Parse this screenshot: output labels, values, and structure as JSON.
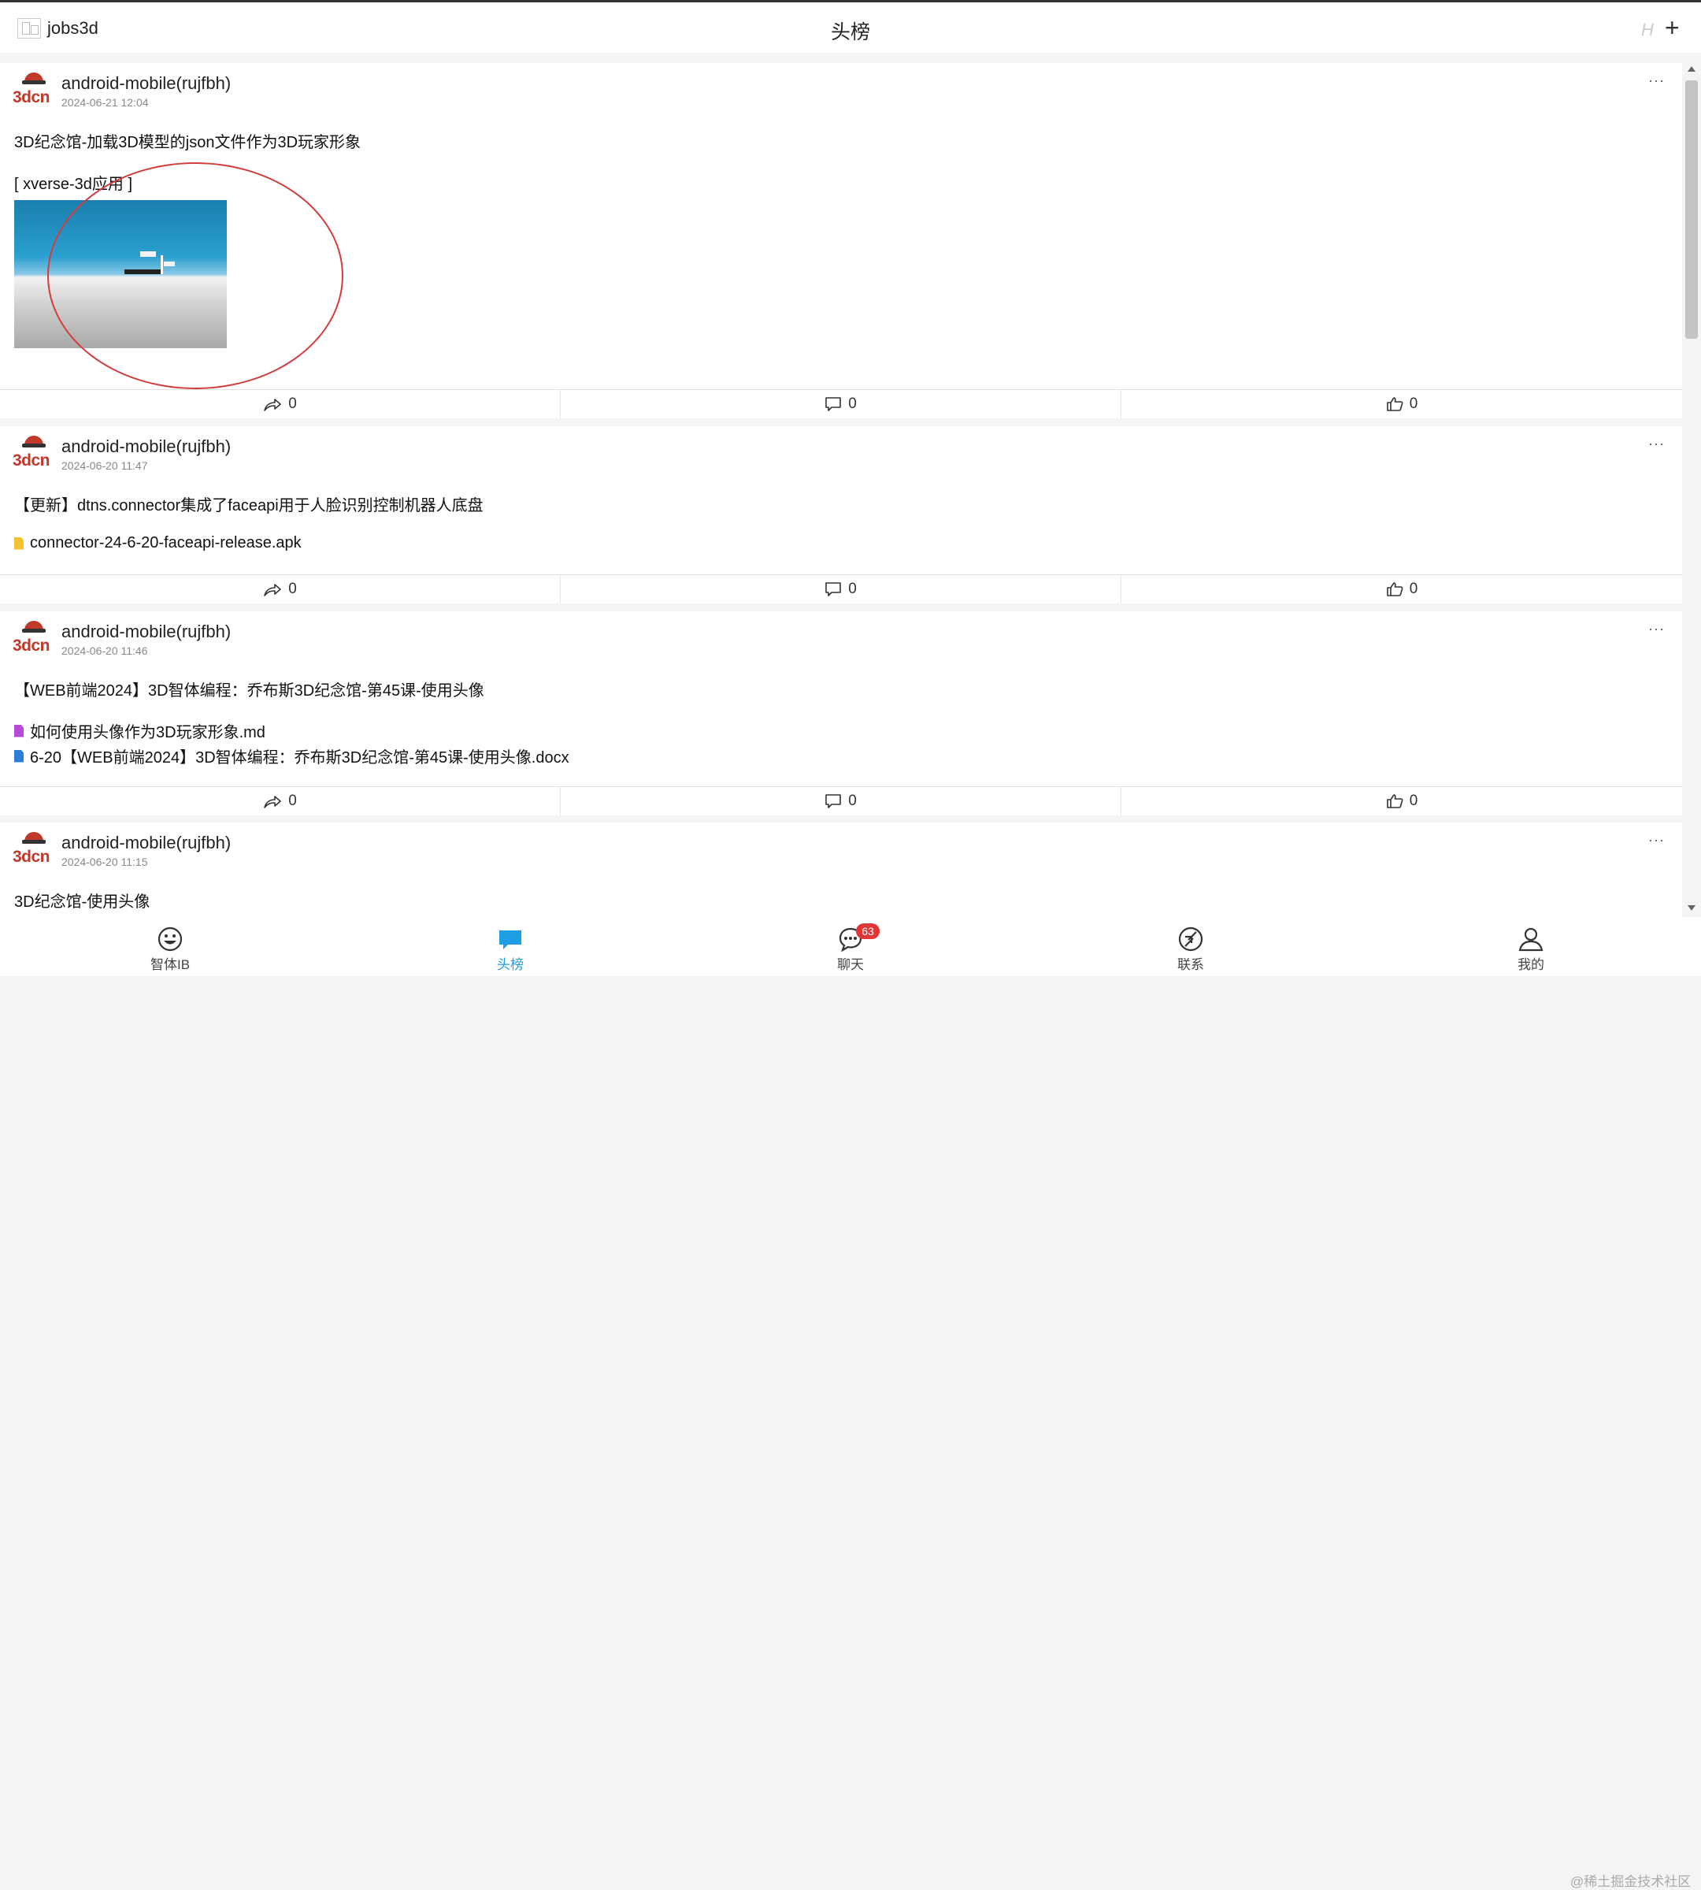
{
  "header": {
    "account_name": "jobs3d",
    "title": "头榜",
    "h_glyph": "H",
    "plus_glyph": "+"
  },
  "avatar_text": "3dcn",
  "more_glyph": "···",
  "posts": [
    {
      "author": "android-mobile(rujfbh)",
      "date": "2024-06-21 12:04",
      "text": "3D纪念馆-加载3D模型的json文件作为3D玩家形象",
      "tag": "[ xverse-3d应用 ]",
      "share_count": "0",
      "comment_count": "0",
      "like_count": "0"
    },
    {
      "author": "android-mobile(rujfbh)",
      "date": "2024-06-20 11:47",
      "text": "【更新】dtns.connector集成了faceapi用于人脸识别控制机器人底盘",
      "files": [
        {
          "name": "connector-24-6-20-faceapi-release.apk",
          "color": "#f2c230"
        }
      ],
      "share_count": "0",
      "comment_count": "0",
      "like_count": "0"
    },
    {
      "author": "android-mobile(rujfbh)",
      "date": "2024-06-20 11:46",
      "text": "【WEB前端2024】3D智体编程：乔布斯3D纪念馆-第45课-使用头像",
      "files": [
        {
          "name": "如何使用头像作为3D玩家形象.md",
          "color": "#b84ad9"
        },
        {
          "name": "6-20【WEB前端2024】3D智体编程：乔布斯3D纪念馆-第45课-使用头像.docx",
          "color": "#2b7fd9"
        }
      ],
      "share_count": "0",
      "comment_count": "0",
      "like_count": "0"
    },
    {
      "author": "android-mobile(rujfbh)",
      "date": "2024-06-20 11:15",
      "text": "3D纪念馆-使用头像"
    }
  ],
  "tabs": [
    {
      "label": "智体IB",
      "icon": "smiley-icon"
    },
    {
      "label": "头榜",
      "icon": "chat-bubble-icon",
      "active": true
    },
    {
      "label": "聊天",
      "icon": "chat-dots-icon",
      "badge": "63"
    },
    {
      "label": "联系",
      "icon": "compass-icon"
    },
    {
      "label": "我的",
      "icon": "user-icon"
    }
  ],
  "watermark": "@稀土掘金技术社区",
  "colors": {
    "accent": "#1e9ee3",
    "badge": "#e23636",
    "brand_red": "#c0392b",
    "annotation": "#d43c3c"
  }
}
